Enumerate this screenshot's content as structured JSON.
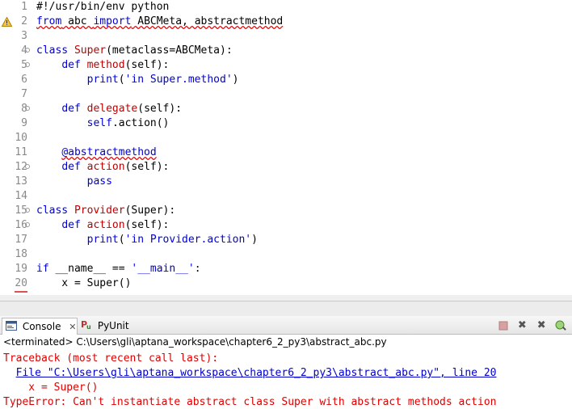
{
  "editor": {
    "lines": [
      {
        "n": "1",
        "parts": [
          {
            "t": "#!/usr/bin/env python",
            "c": "plain"
          }
        ]
      },
      {
        "n": "2",
        "warn": true,
        "parts": [
          {
            "t": "from",
            "c": "kw"
          },
          {
            "t": " abc ",
            "c": "plain"
          },
          {
            "t": "import",
            "c": "kw"
          },
          {
            "t": " ABCMeta, abstractmethod",
            "c": "plain"
          }
        ],
        "squiggle": true
      },
      {
        "n": "3",
        "parts": []
      },
      {
        "n": "4",
        "fold": true,
        "parts": [
          {
            "t": "class",
            "c": "kw"
          },
          {
            "t": " ",
            "c": "plain"
          },
          {
            "t": "Super",
            "c": "fn"
          },
          {
            "t": "(metaclass=ABCMeta):",
            "c": "plain"
          }
        ]
      },
      {
        "n": "5",
        "fold": true,
        "parts": [
          {
            "t": "    ",
            "c": "plain"
          },
          {
            "t": "def",
            "c": "kw"
          },
          {
            "t": " ",
            "c": "plain"
          },
          {
            "t": "method",
            "c": "fn"
          },
          {
            "t": "(self):",
            "c": "plain"
          }
        ]
      },
      {
        "n": "6",
        "parts": [
          {
            "t": "        ",
            "c": "plain"
          },
          {
            "t": "print",
            "c": "kw"
          },
          {
            "t": "(",
            "c": "plain"
          },
          {
            "t": "'in Super.method'",
            "c": "str"
          },
          {
            "t": ")",
            "c": "plain"
          }
        ]
      },
      {
        "n": "7",
        "parts": []
      },
      {
        "n": "8",
        "fold": true,
        "parts": [
          {
            "t": "    ",
            "c": "plain"
          },
          {
            "t": "def",
            "c": "kw"
          },
          {
            "t": " ",
            "c": "plain"
          },
          {
            "t": "delegate",
            "c": "fn"
          },
          {
            "t": "(self):",
            "c": "plain"
          }
        ]
      },
      {
        "n": "9",
        "parts": [
          {
            "t": "        ",
            "c": "plain"
          },
          {
            "t": "self",
            "c": "kw"
          },
          {
            "t": ".action()",
            "c": "plain"
          }
        ]
      },
      {
        "n": "10",
        "parts": []
      },
      {
        "n": "11",
        "parts": [
          {
            "t": "    ",
            "c": "plain"
          },
          {
            "t": "@abstractmethod",
            "c": "kw",
            "sq": true
          }
        ]
      },
      {
        "n": "12",
        "fold": true,
        "parts": [
          {
            "t": "    ",
            "c": "plain"
          },
          {
            "t": "def",
            "c": "kw"
          },
          {
            "t": " ",
            "c": "plain"
          },
          {
            "t": "action",
            "c": "fn"
          },
          {
            "t": "(self):",
            "c": "plain"
          }
        ]
      },
      {
        "n": "13",
        "parts": [
          {
            "t": "        ",
            "c": "plain"
          },
          {
            "t": "pass",
            "c": "kw"
          }
        ]
      },
      {
        "n": "14",
        "parts": []
      },
      {
        "n": "15",
        "fold": true,
        "parts": [
          {
            "t": "class",
            "c": "kw"
          },
          {
            "t": " ",
            "c": "plain"
          },
          {
            "t": "Provider",
            "c": "fn"
          },
          {
            "t": "(Super):",
            "c": "plain"
          }
        ]
      },
      {
        "n": "16",
        "fold": true,
        "parts": [
          {
            "t": "    ",
            "c": "plain"
          },
          {
            "t": "def",
            "c": "kw"
          },
          {
            "t": " ",
            "c": "plain"
          },
          {
            "t": "action",
            "c": "fn"
          },
          {
            "t": "(self):",
            "c": "plain"
          }
        ]
      },
      {
        "n": "17",
        "parts": [
          {
            "t": "        ",
            "c": "plain"
          },
          {
            "t": "print",
            "c": "kw"
          },
          {
            "t": "(",
            "c": "plain"
          },
          {
            "t": "'in Provider.action'",
            "c": "str"
          },
          {
            "t": ")",
            "c": "plain"
          }
        ]
      },
      {
        "n": "18",
        "parts": []
      },
      {
        "n": "19",
        "parts": [
          {
            "t": "if",
            "c": "kw"
          },
          {
            "t": " __name__ == ",
            "c": "plain"
          },
          {
            "t": "'__main__'",
            "c": "str"
          },
          {
            "t": ":",
            "c": "plain"
          }
        ]
      },
      {
        "n": "20",
        "current": true,
        "parts": [
          {
            "t": "    x = Super()",
            "c": "plain"
          }
        ]
      }
    ]
  },
  "console_tabs": {
    "console_label": "Console",
    "pyunit_label": "PyUnit"
  },
  "status": "<terminated> C:\\Users\\gli\\aptana_workspace\\chapter6_2_py3\\abstract_abc.py",
  "console": {
    "traceback": "Traceback (most recent call last):",
    "file_indent": "  ",
    "file_link": "File \"C:\\Users\\gli\\aptana_workspace\\chapter6_2_py3\\abstract_abc.py\", line 20",
    "source_line": "    x = Super()",
    "error": "TypeError: Can't instantiate abstract class Super with abstract methods action"
  },
  "colors": {
    "keyword": "#0000d8",
    "function_name": "#c00000",
    "error_text": "#e00000",
    "link": "#0000cc"
  },
  "icons": [
    "warning-icon",
    "console-icon",
    "pyunit-icon",
    "stop-icon",
    "remove-launch-icon",
    "remove-all-icon",
    "scroll-lock-icon"
  ]
}
